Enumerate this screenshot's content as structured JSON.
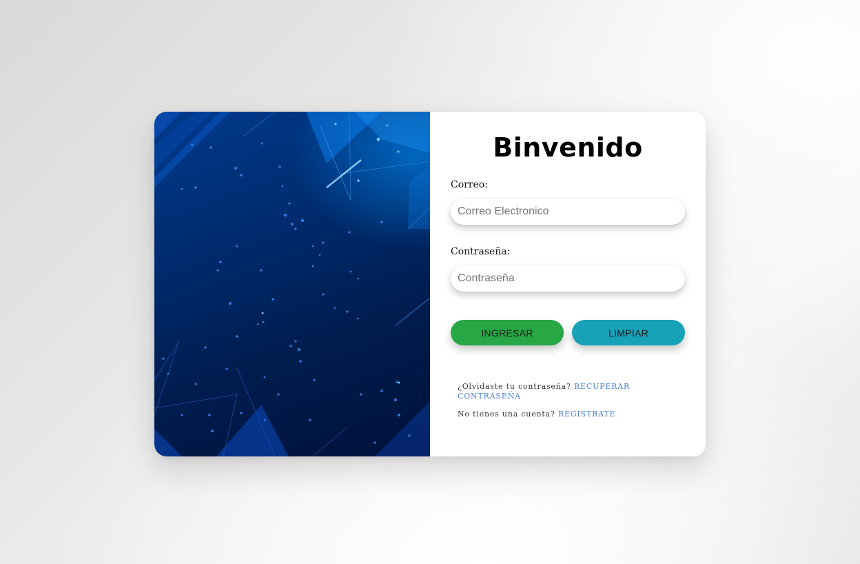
{
  "login": {
    "title": "Binvenido",
    "email_label": "Correo:",
    "email_placeholder": "Correo Electronico",
    "email_value": "",
    "password_label": "Contraseña:",
    "password_placeholder": "Contraseña",
    "password_value": "",
    "submit_label": "INGRESAR",
    "clear_label": "LIMPIAR",
    "forgot_text": "¿Olvidaste tu contraseña?",
    "forgot_link": "RECUPERAR CONTRASEÑA",
    "register_text": "No tienes una cuenta?",
    "register_link": "REGISTRATE"
  },
  "colors": {
    "submit_button": "#28a745",
    "clear_button": "#17a2b8",
    "link": "#4a7fd1",
    "art_gradient_top": "#003a8c",
    "art_gradient_bottom": "#00113a"
  },
  "icons": {
    "background_art": "blue-tech-particles-illustration"
  }
}
